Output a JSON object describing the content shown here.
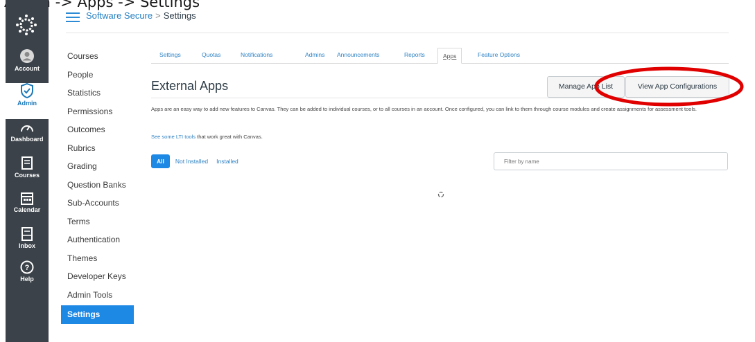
{
  "caption": "Admin -> Apps -> Settings",
  "global_nav": [
    {
      "label": "Account",
      "icon": "account-icon"
    },
    {
      "label": "Admin",
      "icon": "admin-shield-icon",
      "active": true
    },
    {
      "label": "Dashboard",
      "icon": "dashboard-icon"
    },
    {
      "label": "Courses",
      "icon": "courses-icon"
    },
    {
      "label": "Calendar",
      "icon": "calendar-icon"
    },
    {
      "label": "Inbox",
      "icon": "inbox-icon"
    },
    {
      "label": "Help",
      "icon": "help-icon"
    }
  ],
  "breadcrumb": {
    "root": "Software Secure",
    "separator": ">",
    "current": "Settings"
  },
  "sub_nav": [
    "Courses",
    "People",
    "Statistics",
    "Permissions",
    "Outcomes",
    "Rubrics",
    "Grading",
    "Question Banks",
    "Sub-Accounts",
    "Terms",
    "Authentication",
    "Themes",
    "Developer Keys",
    "Admin Tools",
    "Settings"
  ],
  "sub_nav_active": "Settings",
  "tabs": [
    "Settings",
    "Quotas",
    "Notifications",
    "Admins",
    "Announcements",
    "Reports",
    "Apps",
    "Feature Options"
  ],
  "active_tab": "Apps",
  "page_title": "External Apps",
  "buttons": {
    "manage": "Manage App List",
    "view_config": "View App Configurations"
  },
  "description": "Apps are an easy way to add new features to Canvas. They can be added to individual courses, or to all courses in an account. Once configured, you can link to them through course modules and create assignments for assessment tools.",
  "lti": {
    "link": "See some LTI tools",
    "rest": " that work great with Canvas."
  },
  "filters": {
    "all": "All",
    "not_installed": "Not Installed",
    "installed": "Installed"
  },
  "search_placeholder": "Filter by name",
  "colors": {
    "nav_bg": "#3b4249",
    "accent": "#1e88e5",
    "link": "#2f82c4",
    "highlight": "#e00000"
  }
}
